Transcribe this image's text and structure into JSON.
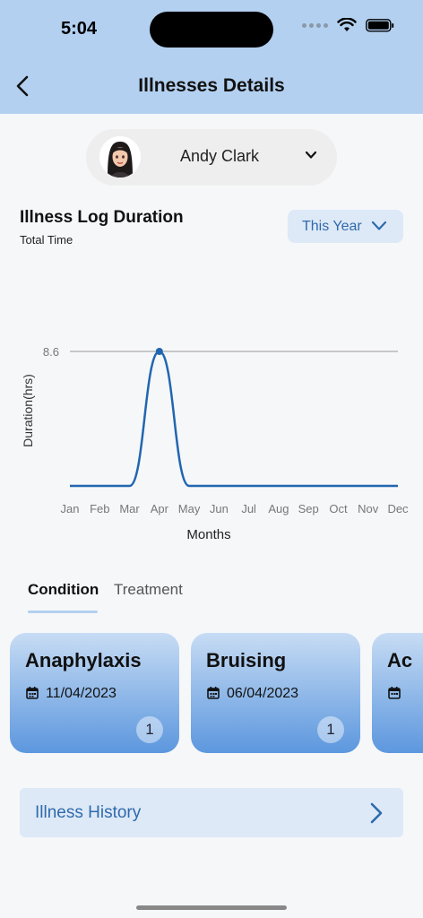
{
  "status": {
    "time": "5:04"
  },
  "header": {
    "title": "Illnesses Details"
  },
  "user": {
    "name": "Andy Clark"
  },
  "section": {
    "title": "Illness Log Duration",
    "subtitle": "Total Time",
    "period": "This Year"
  },
  "chart_data": {
    "type": "line",
    "categories": [
      "Jan",
      "Feb",
      "Mar",
      "Apr",
      "May",
      "Jun",
      "Jul",
      "Aug",
      "Sep",
      "Oct",
      "Nov",
      "Dec"
    ],
    "values": [
      0,
      0,
      0,
      8.6,
      0,
      0,
      0,
      0,
      0,
      0,
      0,
      0
    ],
    "xlabel": "Months",
    "ylabel": "Duration(hrs)",
    "y_tick": "8.6",
    "ylim": [
      0,
      8.6
    ],
    "color": "#2166b0"
  },
  "tabs": {
    "condition": "Condition",
    "treatment": "Treatment"
  },
  "cards": [
    {
      "name": "Anaphylaxis",
      "date": "11/04/2023",
      "count": "1"
    },
    {
      "name": "Bruising",
      "date": "06/04/2023",
      "count": "1"
    },
    {
      "name": "Ac",
      "date": "",
      "count": ""
    }
  ],
  "history": {
    "label": "Illness History"
  }
}
